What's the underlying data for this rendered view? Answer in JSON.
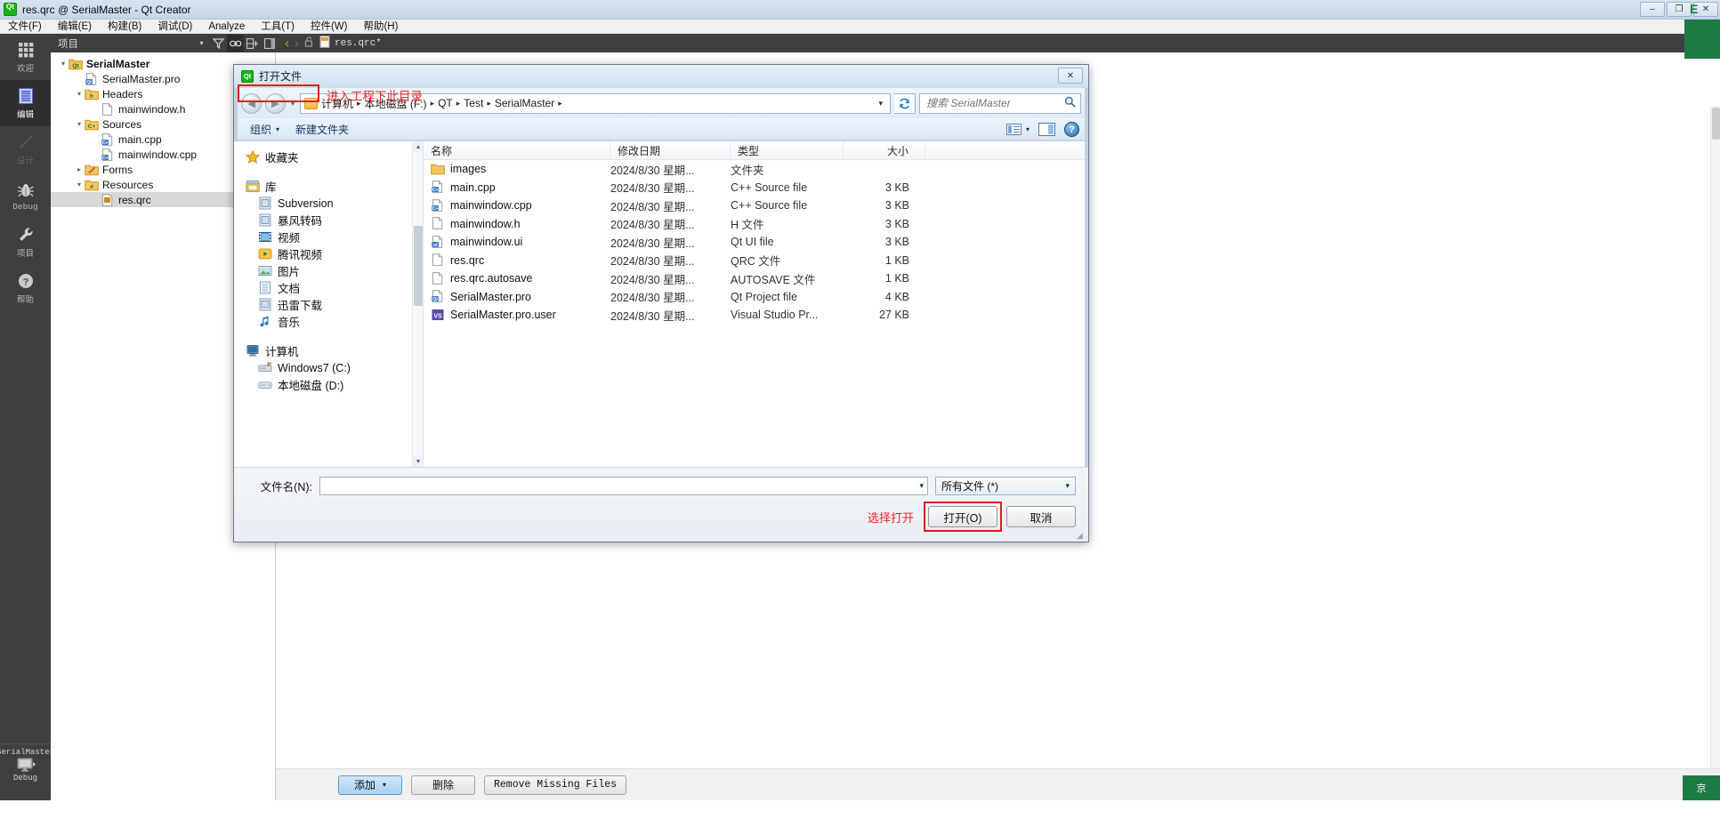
{
  "window": {
    "title": "res.qrc @ SerialMaster - Qt Creator",
    "app_icon": "qt-creator-icon",
    "minimize": "–",
    "maximize": "❐",
    "close": "✕"
  },
  "menubar": {
    "items": [
      {
        "label": "文件(F)"
      },
      {
        "label": "编辑(E)"
      },
      {
        "label": "构建(B)"
      },
      {
        "label": "调试(D)"
      },
      {
        "label": "Analyze"
      },
      {
        "label": "工具(T)"
      },
      {
        "label": "控件(W)"
      },
      {
        "label": "帮助(H)"
      }
    ]
  },
  "modebar": {
    "items": [
      {
        "label": "欢迎",
        "icon": "grid-icon",
        "state": "normal"
      },
      {
        "label": "编辑",
        "icon": "document-icon",
        "state": "active"
      },
      {
        "label": "设计",
        "icon": "pencil-icon",
        "state": "disabled"
      },
      {
        "label": "Debug",
        "icon": "bug-icon",
        "state": "normal"
      },
      {
        "label": "项目",
        "icon": "wrench-icon",
        "state": "normal"
      },
      {
        "label": "帮助",
        "icon": "question-icon",
        "state": "normal"
      }
    ],
    "kit_name": "SerialMaster",
    "build_config": "Debug",
    "run_icon": "monitor-icon"
  },
  "project_toolbar": {
    "title": "项目",
    "icons": [
      "chevron-down-icon",
      "filter-icon",
      "link-icon",
      "split-icon",
      "sidebar-icon"
    ],
    "nav_back": "‹",
    "nav_forward": "›",
    "lock_icon": "unlock-icon",
    "open_tab": "res.qrc*",
    "tab_close": "✕",
    "split_icon": "split-editor-icon"
  },
  "project_tree": {
    "nodes": [
      {
        "label": "SerialMaster",
        "indent": 0,
        "arrow": "▾",
        "icon": "qt-project-icon",
        "bold": true,
        "selected": false
      },
      {
        "label": "SerialMaster.pro",
        "indent": 1,
        "arrow": "",
        "icon": "pro-file-icon",
        "bold": false,
        "selected": false
      },
      {
        "label": "Headers",
        "indent": 1,
        "arrow": "▾",
        "icon": "headers-folder-icon",
        "bold": false,
        "selected": false
      },
      {
        "label": "mainwindow.h",
        "indent": 2,
        "arrow": "",
        "icon": "h-file-icon",
        "bold": false,
        "selected": false
      },
      {
        "label": "Sources",
        "indent": 1,
        "arrow": "▾",
        "icon": "sources-folder-icon",
        "bold": false,
        "selected": false
      },
      {
        "label": "main.cpp",
        "indent": 2,
        "arrow": "",
        "icon": "cpp-file-icon",
        "bold": false,
        "selected": false
      },
      {
        "label": "mainwindow.cpp",
        "indent": 2,
        "arrow": "",
        "icon": "cpp-file-icon",
        "bold": false,
        "selected": false
      },
      {
        "label": "Forms",
        "indent": 1,
        "arrow": "▸",
        "icon": "forms-folder-icon",
        "bold": false,
        "selected": false
      },
      {
        "label": "Resources",
        "indent": 1,
        "arrow": "▾",
        "icon": "resources-folder-icon",
        "bold": false,
        "selected": false
      },
      {
        "label": "res.qrc",
        "indent": 2,
        "arrow": "",
        "icon": "qrc-file-icon",
        "bold": false,
        "selected": true
      }
    ]
  },
  "qrc_editor": {
    "buttons": [
      {
        "label": "添加",
        "style": "blue",
        "caret": "▾",
        "name": "add-button"
      },
      {
        "label": "删除",
        "style": "plain",
        "caret": "",
        "name": "remove-button"
      },
      {
        "label": "Remove Missing Files",
        "style": "mono",
        "caret": "",
        "name": "remove-missing-files-button"
      }
    ]
  },
  "dialog": {
    "title": "打开文件",
    "icon": "qt-creator-icon",
    "close_label": "✕",
    "nav": {
      "back_icon": "back-arrow-icon",
      "forward_icon": "forward-arrow-icon",
      "history_caret": "▾",
      "breadcrumb": [
        "计算机",
        "本地磁盘 (F:)",
        "QT",
        "Test",
        "SerialMaster"
      ],
      "breadcrumb_trailing_sep": "▸",
      "dropdown_caret": "▾",
      "refresh_icon": "refresh-icon"
    },
    "search": {
      "placeholder": "搜索 SerialMaster",
      "value": "",
      "icon": "search-icon"
    },
    "commandbar": {
      "organize": "组织",
      "organize_caret": "▾",
      "new_folder": "新建文件夹",
      "view_icon": "view-list-icon",
      "view_caret": "▾",
      "preview_icon": "preview-pane-icon",
      "help_icon": "help-icon"
    },
    "places": [
      {
        "label": "收藏夹",
        "icon": "star-icon",
        "level": 0
      },
      {
        "label": "库",
        "icon": "library-icon",
        "level": 0
      },
      {
        "label": "Subversion",
        "icon": "library-item-icon",
        "level": 1
      },
      {
        "label": "暴风转码",
        "icon": "library-item-icon",
        "level": 1
      },
      {
        "label": "视频",
        "icon": "video-icon",
        "level": 1
      },
      {
        "label": "腾讯视频",
        "icon": "tencent-video-icon",
        "level": 1
      },
      {
        "label": "图片",
        "icon": "pictures-icon",
        "level": 1
      },
      {
        "label": "文档",
        "icon": "documents-icon",
        "level": 1
      },
      {
        "label": "迅雷下载",
        "icon": "thunder-download-icon",
        "level": 1
      },
      {
        "label": "音乐",
        "icon": "music-icon",
        "level": 1
      },
      {
        "label": "计算机",
        "icon": "computer-icon",
        "level": 0
      },
      {
        "label": "Windows7 (C:)",
        "icon": "system-drive-icon",
        "level": 1
      },
      {
        "label": "本地磁盘 (D:)",
        "icon": "drive-icon",
        "level": 1
      }
    ],
    "columns": [
      {
        "label": "名称",
        "key": "name"
      },
      {
        "label": "修改日期",
        "key": "date"
      },
      {
        "label": "类型",
        "key": "type"
      },
      {
        "label": "大小",
        "key": "size"
      }
    ],
    "files": [
      {
        "name": "images",
        "date": "2024/8/30 星期...",
        "type": "文件夹",
        "size": "",
        "icon": "folder-icon",
        "highlighted": true
      },
      {
        "name": "main.cpp",
        "date": "2024/8/30 星期...",
        "type": "C++ Source file",
        "size": "3 KB",
        "icon": "cpp-file-icon",
        "highlighted": false
      },
      {
        "name": "mainwindow.cpp",
        "date": "2024/8/30 星期...",
        "type": "C++ Source file",
        "size": "3 KB",
        "icon": "cpp-file-icon",
        "highlighted": false
      },
      {
        "name": "mainwindow.h",
        "date": "2024/8/30 星期...",
        "type": "H 文件",
        "size": "3 KB",
        "icon": "h-file-icon",
        "highlighted": false
      },
      {
        "name": "mainwindow.ui",
        "date": "2024/8/30 星期...",
        "type": "Qt UI file",
        "size": "3 KB",
        "icon": "ui-file-icon",
        "highlighted": false
      },
      {
        "name": "res.qrc",
        "date": "2024/8/30 星期...",
        "type": "QRC 文件",
        "size": "1 KB",
        "icon": "blank-file-icon",
        "highlighted": false
      },
      {
        "name": "res.qrc.autosave",
        "date": "2024/8/30 星期...",
        "type": "AUTOSAVE 文件",
        "size": "1 KB",
        "icon": "blank-file-icon",
        "highlighted": false
      },
      {
        "name": "SerialMaster.pro",
        "date": "2024/8/30 星期...",
        "type": "Qt Project file",
        "size": "4 KB",
        "icon": "pro-file-icon",
        "highlighted": false
      },
      {
        "name": "SerialMaster.pro.user",
        "date": "2024/8/30 星期...",
        "type": "Visual Studio Pr...",
        "size": "27 KB",
        "icon": "user-file-icon",
        "highlighted": false
      }
    ],
    "filename": {
      "label": "文件名(N):",
      "value": "",
      "caret": "▾"
    },
    "filter": {
      "value": "所有文件 (*)",
      "caret": "▾"
    },
    "buttons": {
      "open": "打开(O)",
      "cancel": "取消"
    }
  },
  "annotations": {
    "enter_dir": "进入工程下此目录",
    "choose_open": "选择打开"
  },
  "colors": {
    "accent_red": "#e8262a",
    "mode_active_bg": "#2e2e2e",
    "qt_green": "#19b319",
    "status_green": "#1e7a45"
  }
}
